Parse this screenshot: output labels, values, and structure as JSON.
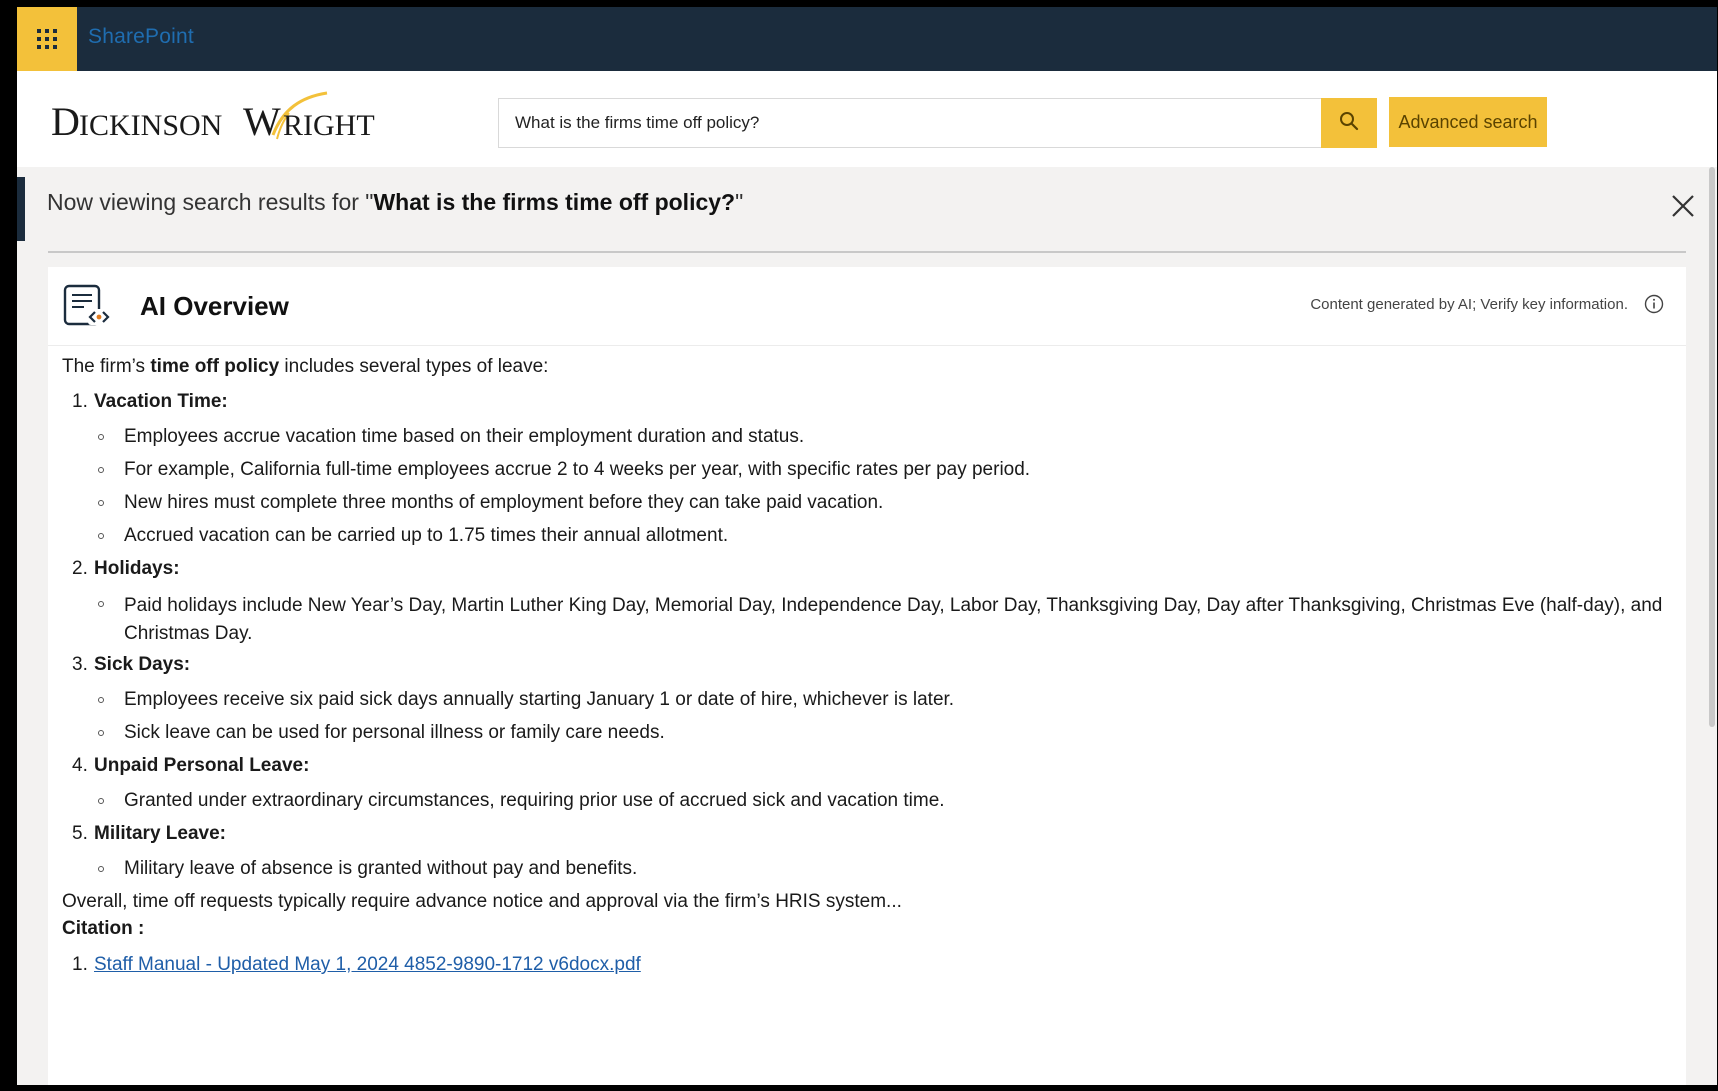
{
  "suite": {
    "app_name": "SharePoint"
  },
  "header": {
    "logo_text": "DICKINSONWRIGHT",
    "search_value": "What is the firms time off policy?",
    "advanced_search_label": "Advanced search"
  },
  "results": {
    "banner_prefix": "Now viewing search results for \"",
    "banner_query": "What is the firms time off policy?",
    "banner_suffix": "\""
  },
  "ai_overview": {
    "title": "AI Overview",
    "disclaimer": "Content generated by AI; Verify key information.",
    "intro_pre": "The firm’s ",
    "intro_bold": "time off policy",
    "intro_post": " includes several types of leave:",
    "sections": [
      {
        "num": "1.",
        "heading": "Vacation Time:",
        "bullets": [
          "Employees accrue vacation time based on their employment duration and status.",
          "For example, California full-time employees accrue 2 to 4 weeks per year, with specific rates per pay period.",
          "New hires must complete three months of employment before they can take paid vacation.",
          "Accrued vacation can be carried up to 1.75 times their annual allotment."
        ]
      },
      {
        "num": "2.",
        "heading": "Holidays:",
        "bullets": [
          "Paid holidays include New Year’s Day, Martin Luther King Day, Memorial Day, Independence Day, Labor Day, Thanksgiving Day, Day after Thanksgiving, Christmas Eve (half-day), and Christmas Day."
        ]
      },
      {
        "num": "3.",
        "heading": "Sick Days:",
        "bullets": [
          "Employees receive six paid sick days annually starting January 1 or date of hire, whichever is later.",
          "Sick leave can be used for personal illness or family care needs."
        ]
      },
      {
        "num": "4.",
        "heading": "Unpaid Personal Leave:",
        "bullets": [
          "Granted under extraordinary circumstances, requiring prior use of accrued sick and vacation time."
        ]
      },
      {
        "num": "5.",
        "heading": "Military Leave:",
        "bullets": [
          "Military leave of absence is granted without pay and benefits."
        ]
      }
    ],
    "closing": "Overall, time off requests typically require advance notice and approval via the firm’s HRIS system...",
    "citation_label": "Citation :",
    "citations": [
      {
        "num": "1.",
        "text": "Staff Manual - Updated May 1, 2024 4852-9890-1712 v6docx.pdf"
      }
    ]
  },
  "icons": {
    "waffle": "app-launcher-icon",
    "search": "search-icon",
    "close": "close-icon",
    "ai": "ai-overview-icon",
    "info": "info-icon"
  },
  "colors": {
    "suite_bar": "#1b2c3d",
    "accent_gold": "#f3c13a",
    "link": "#1f5ea8"
  }
}
